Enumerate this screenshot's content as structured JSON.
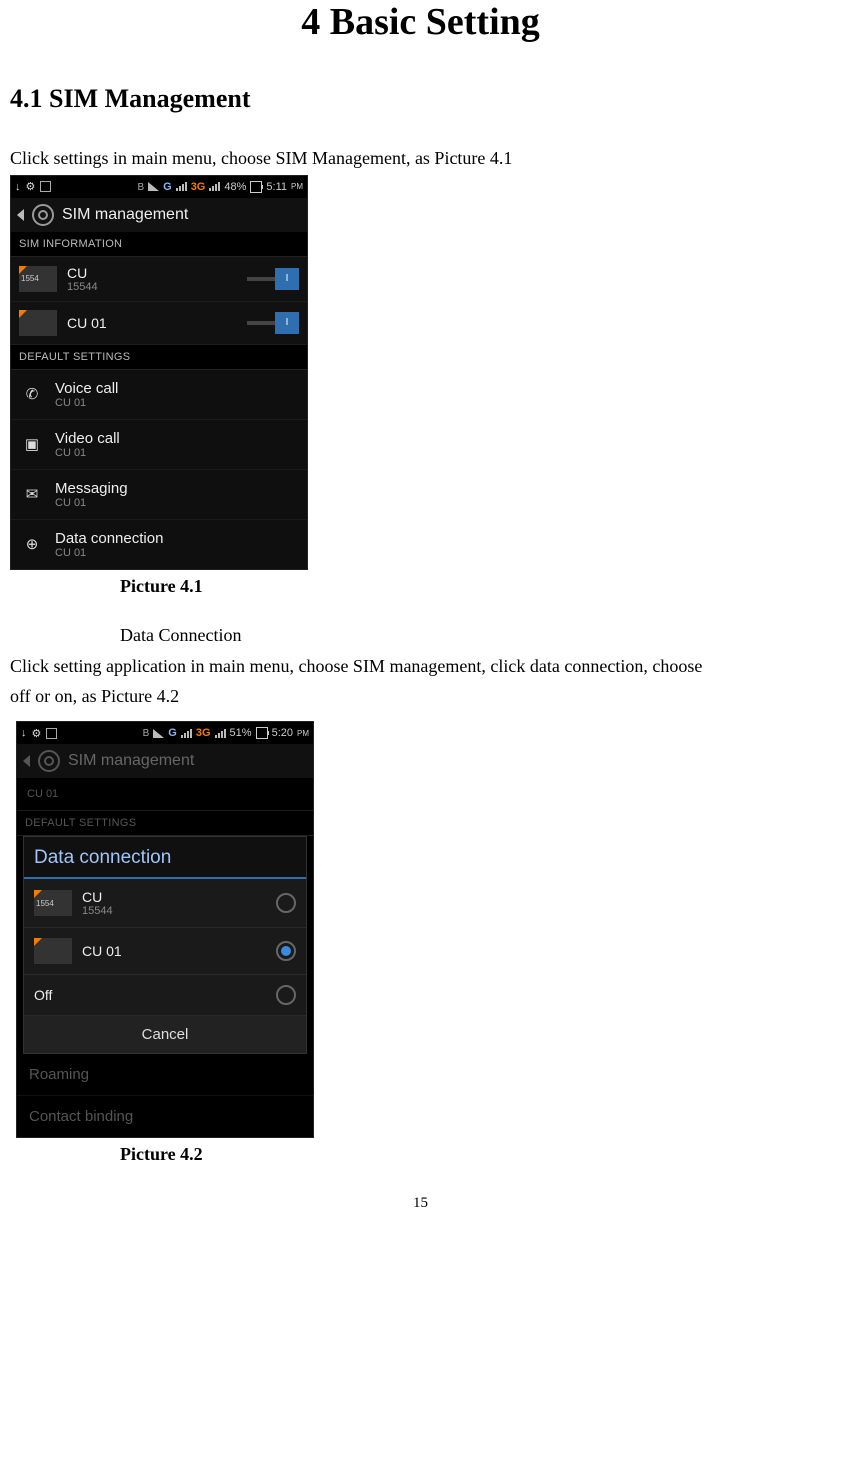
{
  "doc": {
    "title": "4 Basic Setting",
    "section": "4.1 SIM Management",
    "para1": "Click settings in main menu, choose SIM Management, as Picture 4.1",
    "caption1": "Picture 4.1",
    "sub_heading": "Data Connection",
    "para2a": "Click setting application in main menu, choose SIM management, click data connection, choose",
    "para2b": "off or on, as Picture 4.2",
    "caption2": "Picture 4.2",
    "page_number": "15"
  },
  "phone1": {
    "status": {
      "g_label": "G",
      "threeg_label": "3G",
      "battery_pct": "48%",
      "time": "5:11",
      "ampm": "PM"
    },
    "header_title": "SIM management",
    "section_sim_info": "SIM INFORMATION",
    "sims": [
      {
        "chip_label": "1554",
        "name": "CU",
        "sub": "15544",
        "toggle_label": "I"
      },
      {
        "chip_label": "",
        "name": "CU 01",
        "sub": "",
        "toggle_label": "I"
      }
    ],
    "section_defaults": "DEFAULT SETTINGS",
    "defaults": [
      {
        "icon": "phone-icon",
        "glyph": "✆",
        "title": "Voice call",
        "sub": "CU 01"
      },
      {
        "icon": "video-icon",
        "glyph": "▣",
        "title": "Video call",
        "sub": "CU 01"
      },
      {
        "icon": "message-icon",
        "glyph": "✉",
        "title": "Messaging",
        "sub": "CU 01"
      },
      {
        "icon": "globe-icon",
        "glyph": "⊕",
        "title": "Data connection",
        "sub": "CU 01"
      }
    ]
  },
  "phone2": {
    "status": {
      "g_label": "G",
      "threeg_label": "3G",
      "battery_pct": "51%",
      "time": "5:20",
      "ampm": "PM"
    },
    "header_title": "SIM management",
    "faded_row": "CU 01",
    "section_defaults": "DEFAULT SETTINGS",
    "dialog": {
      "title": "Data connection",
      "options": [
        {
          "chip_label": "1554",
          "name": "CU",
          "sub": "15544",
          "selected": false
        },
        {
          "chip_label": "",
          "name": "CU 01",
          "sub": "",
          "selected": true
        },
        {
          "chip_label": null,
          "name": "Off",
          "sub": "",
          "selected": false
        }
      ],
      "cancel": "Cancel"
    },
    "tail_rows": [
      "Roaming",
      "Contact binding"
    ]
  }
}
